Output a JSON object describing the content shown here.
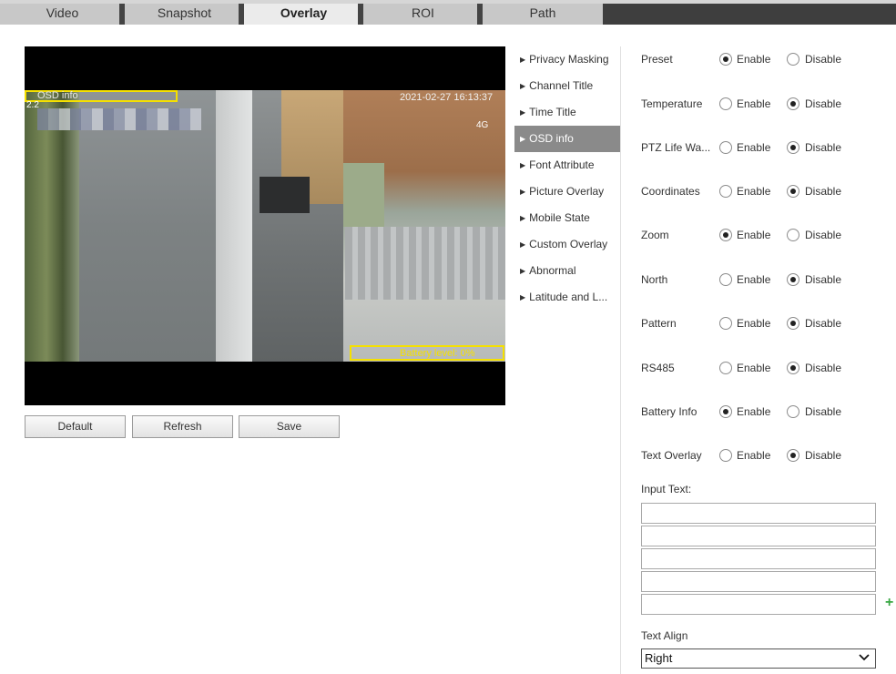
{
  "tabs": [
    {
      "label": "Video",
      "active": false
    },
    {
      "label": "Snapshot",
      "active": false
    },
    {
      "label": "Overlay",
      "active": true
    },
    {
      "label": "ROI",
      "active": false
    },
    {
      "label": "Path",
      "active": false
    }
  ],
  "video": {
    "overlay_title": "OSD info",
    "overlay_small": "2.2",
    "timestamp": "2021-02-27 16:13:37",
    "network": "4G",
    "battery_text": "Battery level: 0%"
  },
  "buttons": {
    "default": "Default",
    "refresh": "Refresh",
    "save": "Save"
  },
  "menu": [
    {
      "label": "Privacy Masking",
      "active": false
    },
    {
      "label": "Channel Title",
      "active": false
    },
    {
      "label": "Time Title",
      "active": false
    },
    {
      "label": "OSD info",
      "active": true
    },
    {
      "label": "Font Attribute",
      "active": false
    },
    {
      "label": "Picture Overlay",
      "active": false
    },
    {
      "label": "Mobile State",
      "active": false
    },
    {
      "label": "Custom Overlay",
      "active": false
    },
    {
      "label": "Abnormal",
      "active": false
    },
    {
      "label": "Latitude and L...",
      "active": false
    }
  ],
  "settings": {
    "enable_label": "Enable",
    "disable_label": "Disable",
    "rows": [
      {
        "label": "Preset",
        "value": "Enable"
      },
      {
        "label": "Temperature",
        "value": "Disable"
      },
      {
        "label": "PTZ Life Wa...",
        "value": "Disable"
      },
      {
        "label": "Coordinates",
        "value": "Disable"
      },
      {
        "label": "Zoom",
        "value": "Enable"
      },
      {
        "label": "North",
        "value": "Disable"
      },
      {
        "label": "Pattern",
        "value": "Disable"
      },
      {
        "label": "RS485",
        "value": "Disable"
      },
      {
        "label": "Battery Info",
        "value": "Enable"
      },
      {
        "label": "Text Overlay",
        "value": "Disable"
      }
    ]
  },
  "input_text": {
    "label": "Input Text:",
    "lines": [
      "",
      "",
      "",
      "",
      ""
    ]
  },
  "text_align": {
    "label": "Text Align",
    "selected": "Right"
  },
  "colors": {
    "active_tab": "#ebebeb",
    "menu_active": "#8a8a8a",
    "osd_box": "#f5e000",
    "plus": "#3aa845"
  }
}
